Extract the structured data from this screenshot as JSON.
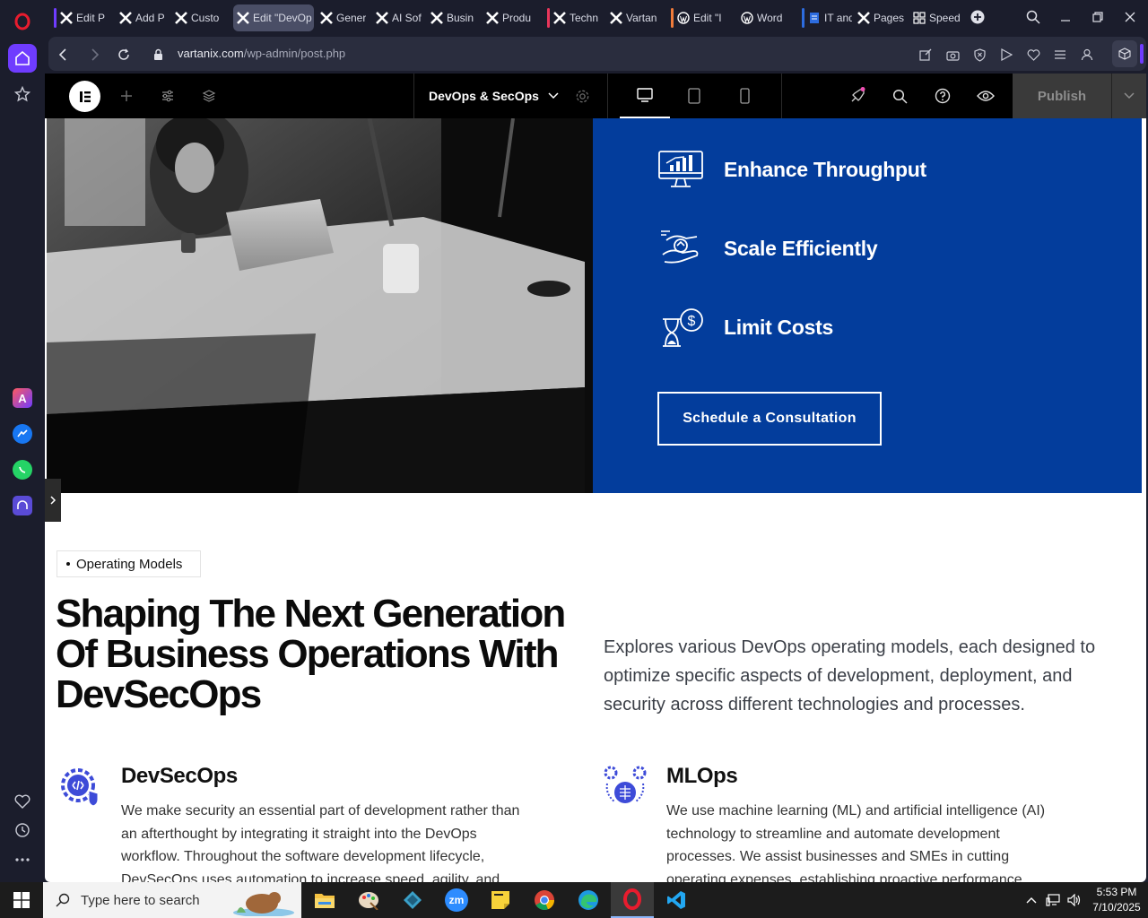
{
  "browser": {
    "tabs": [
      {
        "label": "Edit P",
        "icon": "x-logo-icon",
        "strip": "#6f3cff"
      },
      {
        "label": "Add P",
        "icon": "x-logo-icon"
      },
      {
        "label": "Custo",
        "icon": "x-logo-icon"
      },
      {
        "label": "Edit \"DevOp",
        "icon": "x-logo-icon",
        "active": true
      },
      {
        "label": "Gener",
        "icon": "x-logo-icon"
      },
      {
        "label": "AI Sof",
        "icon": "x-logo-icon"
      },
      {
        "label": "Busin",
        "icon": "x-logo-icon"
      },
      {
        "label": "Produ",
        "icon": "x-logo-icon"
      },
      {
        "label": "Techn",
        "icon": "x-logo-icon",
        "strip": "#e8365a"
      },
      {
        "label": "Vartan",
        "icon": "x-logo-icon"
      },
      {
        "label": "Edit \"I",
        "icon": "wordpress-icon",
        "strip": "#f07b3a"
      },
      {
        "label": "Word",
        "icon": "wordpress-icon"
      },
      {
        "label": "IT and",
        "icon": "doc-icon",
        "strip": "#2d6cdf"
      },
      {
        "label": "Pages",
        "icon": "x-logo-icon"
      },
      {
        "label": "Speed",
        "icon": "grid-icon"
      }
    ],
    "url_host": "vartanix.com",
    "url_path": "/wp-admin/post.php"
  },
  "editor": {
    "page_name": "DevOps & SecOps",
    "publish_label": "Publish"
  },
  "hero": {
    "features": [
      {
        "label": "Enhance Throughput",
        "icon": "monitor-chart-icon"
      },
      {
        "label": "Scale Efficiently",
        "icon": "hand-scale-icon"
      },
      {
        "label": "Limit Costs",
        "icon": "hourglass-dollar-icon"
      }
    ],
    "cta_label": "Schedule a Consultation"
  },
  "section": {
    "badge": "Operating Models",
    "heading": "Shaping The Next Generation Of Business Operations With DevSecOps",
    "intro": "Explores various DevOps operating models, each designed to optimize specific aspects of development, deployment, and security across different technologies and processes.",
    "cards": [
      {
        "title": "DevSecOps",
        "icon": "gear-shield-code-icon",
        "body": "We make security an essential part of development rather than an afterthought by integrating it straight into the DevOps workflow. Throughout the software development lifecycle, DevSecOps uses automation to increase speed, agility, and"
      },
      {
        "title": "MLOps",
        "icon": "ai-brain-gears-icon",
        "body": "We use machine learning (ML) and artificial intelligence (AI) technology to streamline and automate development processes. We assist businesses and SMEs in cutting operating expenses, establishing proactive performance monitoring, and"
      }
    ]
  },
  "taskbar": {
    "search_placeholder": "Type here to search",
    "time": "5:53 PM",
    "date": "7/10/2025"
  },
  "colors": {
    "hero_blue": "#033d9c",
    "accent_purple": "#6f3cff",
    "publish_bg": "#3a3a3a"
  }
}
